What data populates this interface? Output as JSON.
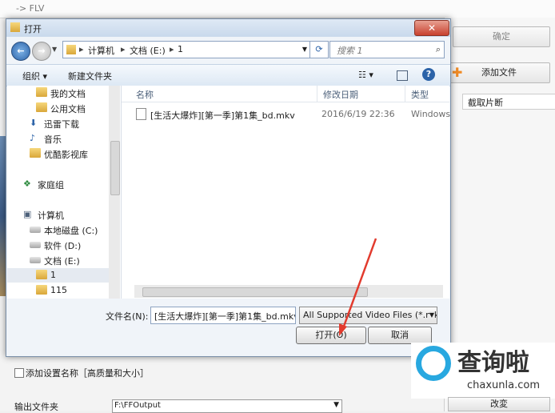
{
  "background_app": {
    "title": "-> FLV",
    "confirm_label": "确定",
    "add_file_label": "添加文件",
    "clip_label": "截取片断",
    "add_settings_label": "添加设置名称［高质量和大小］",
    "output_folder_label": "输出文件夹",
    "output_folder_value": "F:\\FFOutput",
    "change_label": "改変"
  },
  "dialog": {
    "title": "打开",
    "close_glyph": "✕",
    "breadcrumb": [
      "计算机",
      "文档 (E:)",
      "1"
    ],
    "search_placeholder": "搜索 1",
    "toolbar": {
      "organize": "组织 ▾",
      "new_folder": "新建文件夹"
    },
    "nav": {
      "items": [
        "我的文档",
        "公用文档",
        "迅雷下载",
        "音乐",
        "优酷影视库",
        "家庭组",
        "计算机",
        "本地磁盘 (C:)",
        "软件 (D:)",
        "文档 (E:)",
        "1",
        "115"
      ]
    },
    "columns": [
      "名称",
      "修改日期",
      "类型"
    ],
    "files": [
      {
        "name": "[生活大爆炸][第一季]第1集_bd.mkv",
        "date": "2016/6/19 22:36",
        "type": "Windows"
      }
    ],
    "filename_label": "文件名(N):",
    "filename_value": "[生活大爆炸][第一季]第1集_bd.mkv",
    "filter_value": "All Supported Video Files (*.mkv)",
    "open_label": "打开(O)",
    "cancel_label": "取消"
  },
  "watermark": {
    "text": "查询啦",
    "url": "chaxunla.com"
  },
  "colors": {
    "accent": "#2c63a8",
    "watermark": "#28a8e0"
  }
}
